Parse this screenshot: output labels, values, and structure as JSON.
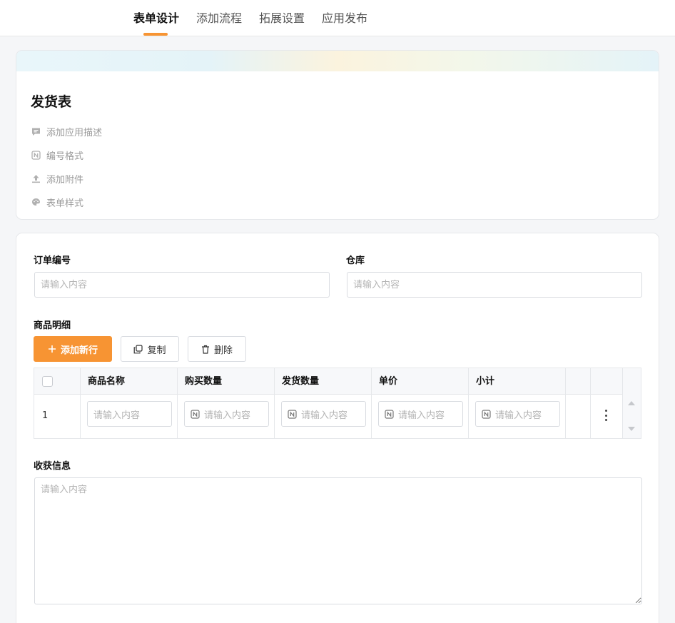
{
  "tabs": [
    {
      "label": "表单设计",
      "active": true
    },
    {
      "label": "添加流程",
      "active": false
    },
    {
      "label": "拓展设置",
      "active": false
    },
    {
      "label": "应用发布",
      "active": false
    }
  ],
  "header": {
    "title": "发货表",
    "items": [
      {
        "label": "添加应用描述",
        "icon": "comment-icon"
      },
      {
        "label": "编号格式",
        "icon": "number-format-icon"
      },
      {
        "label": "添加附件",
        "icon": "upload-icon"
      },
      {
        "label": "表单样式",
        "icon": "palette-icon"
      }
    ]
  },
  "form": {
    "order_no": {
      "label": "订单编号",
      "placeholder": "请输入内容"
    },
    "warehouse": {
      "label": "仓库",
      "placeholder": "请输入内容"
    },
    "details": {
      "label": "商品明细",
      "buttons": {
        "add": "添加新行",
        "copy": "复制",
        "delete": "删除"
      },
      "columns": [
        "商品名称",
        "购买数量",
        "发货数量",
        "单价",
        "小计"
      ],
      "rows": [
        {
          "index": "1",
          "cells": [
            "请输入内容",
            "请输入内容",
            "请输入内容",
            "请输入内容",
            "请输入内容"
          ]
        }
      ]
    },
    "receipt": {
      "label": "收获信息",
      "placeholder": "请输入内容"
    }
  },
  "colors": {
    "accent": "#f79433",
    "border": "#d9dce1",
    "header_bg": "#f7f8fa"
  }
}
